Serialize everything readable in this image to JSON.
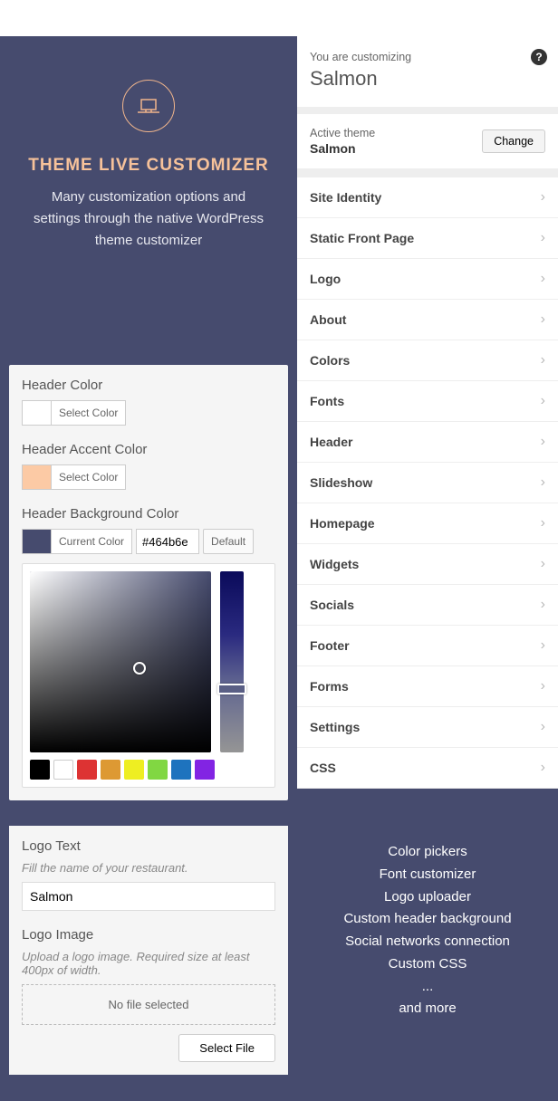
{
  "hero": {
    "title": "THEME LIVE CUSTOMIZER",
    "desc": "Many customization options and settings through the native WordPress theme customizer"
  },
  "colorPanel": {
    "headerColor": {
      "label": "Header Color",
      "button": "Select Color"
    },
    "accentColor": {
      "label": "Header Accent Color",
      "button": "Select Color"
    },
    "bgColor": {
      "label": "Header Background Color",
      "button": "Current Color",
      "hex": "#464b6e",
      "default": "Default"
    },
    "presets": [
      "#000000",
      "#ffffff",
      "#dd3333",
      "#dd9933",
      "#eeee22",
      "#81d742",
      "#1e73be",
      "#8224e3"
    ]
  },
  "logoPanel": {
    "textLabel": "Logo Text",
    "textDesc": "Fill the name of your restaurant.",
    "textValue": "Salmon",
    "imageLabel": "Logo Image",
    "imageDesc": "Upload a logo image. Required size at least 400px of width.",
    "noFile": "No file selected",
    "selectFile": "Select File"
  },
  "customizer": {
    "subtitle": "You are customizing",
    "title": "Salmon",
    "themeLabel": "Active theme",
    "themeName": "Salmon",
    "changeBtn": "Change",
    "menus": [
      "Site Identity",
      "Static Front Page",
      "Logo",
      "About",
      "Colors",
      "Fonts",
      "Header",
      "Slideshow",
      "Homepage",
      "Widgets",
      "Socials",
      "Footer",
      "Forms",
      "Settings",
      "CSS"
    ]
  },
  "features": [
    "Color pickers",
    "Font customizer",
    "Logo uploader",
    "Custom header background",
    "Social networks connection",
    "Custom CSS",
    "...",
    "and more"
  ]
}
